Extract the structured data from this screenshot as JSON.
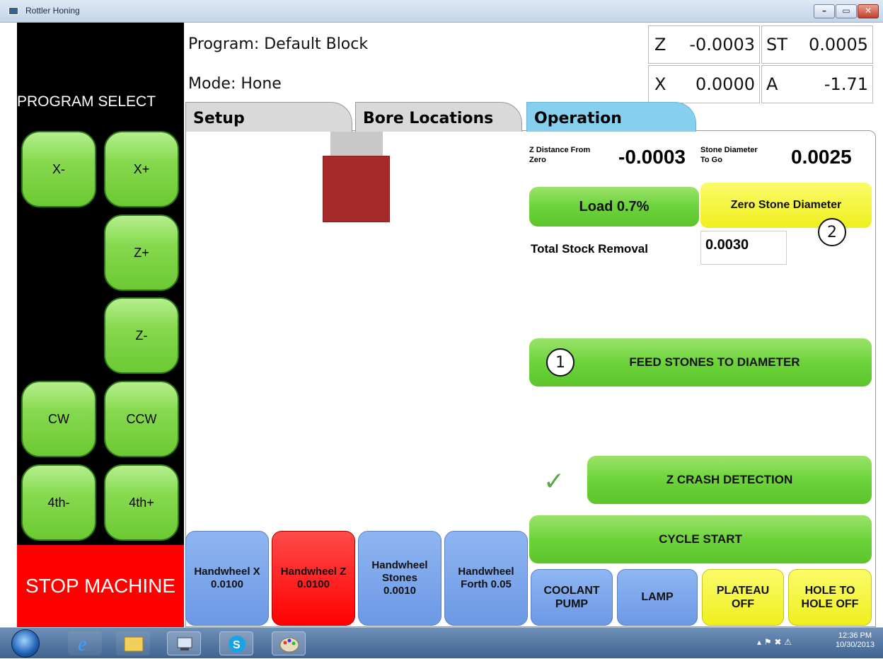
{
  "window": {
    "title": "Rottler Honing",
    "buttons": [
      "–",
      "▭",
      "✕"
    ]
  },
  "left_panel": {
    "program_select": "PROGRAM SELECT",
    "jog_buttons": {
      "x_minus": "X-",
      "x_plus": "X+",
      "z_plus": "Z+",
      "z_minus": "Z-",
      "cw": "CW",
      "ccw": "CCW",
      "fourth_minus": "4th-",
      "fourth_plus": "4th+"
    },
    "stop": "STOP MACHINE"
  },
  "header": {
    "program": "Program: Default Block",
    "mode": "Mode: Hone",
    "axes": [
      {
        "label": "Z",
        "value": "-0.0003"
      },
      {
        "label": "ST",
        "value": "0.0005"
      },
      {
        "label": "X",
        "value": "0.0000"
      },
      {
        "label": "A",
        "value": "-1.71"
      }
    ]
  },
  "tabs": [
    {
      "label": "Setup",
      "active": false
    },
    {
      "label": "Bore Locations",
      "active": false
    },
    {
      "label": "Operation",
      "active": true
    }
  ],
  "operation": {
    "z_distance_label_1": "Z Distance From",
    "z_distance_label_2": "Zero",
    "z_distance_value": "-0.0003",
    "stone_diam_label_1": "Stone Diameter",
    "stone_diam_label_2": "To Go",
    "stone_diam_value": "0.0025",
    "load": "Load 0.7%",
    "zero_stone": "Zero Stone Diameter",
    "marker_2": "2",
    "total_stock_label": "Total Stock Removal",
    "total_stock_value": "0.0030",
    "marker_1": "1",
    "feed_stones": "FEED STONES TO DIAMETER",
    "check": "✓",
    "z_crash": "Z CRASH DETECTION",
    "cycle_start": "CYCLE START"
  },
  "bottom_buttons": {
    "hw_x_1": "Handwheel X",
    "hw_x_2": "0.0100",
    "hw_z_1": "Handwheel Z",
    "hw_z_2": "0.0100",
    "hw_st_1": "Handwheel",
    "hw_st_2": "Stones",
    "hw_st_3": "0.0010",
    "hw_f_1": "Handwheel",
    "hw_f_2": "Forth 0.05",
    "coolant_1": "COOLANT",
    "coolant_2": "PUMP",
    "lamp": "LAMP",
    "plateau_1": "PLATEAU",
    "plateau_2": "OFF",
    "hole_1": "HOLE TO",
    "hole_2": "HOLE OFF"
  },
  "taskbar": {
    "time": "12:36 PM",
    "date": "10/30/2013"
  },
  "colors": {
    "green": "#6cd33b",
    "yellow": "#efef1f",
    "blue": "#6c99e6",
    "red": "#ff0000",
    "tab_active": "#87cfee",
    "tab_inactive": "#d9d9d9",
    "spindle": "#a52a2a"
  }
}
